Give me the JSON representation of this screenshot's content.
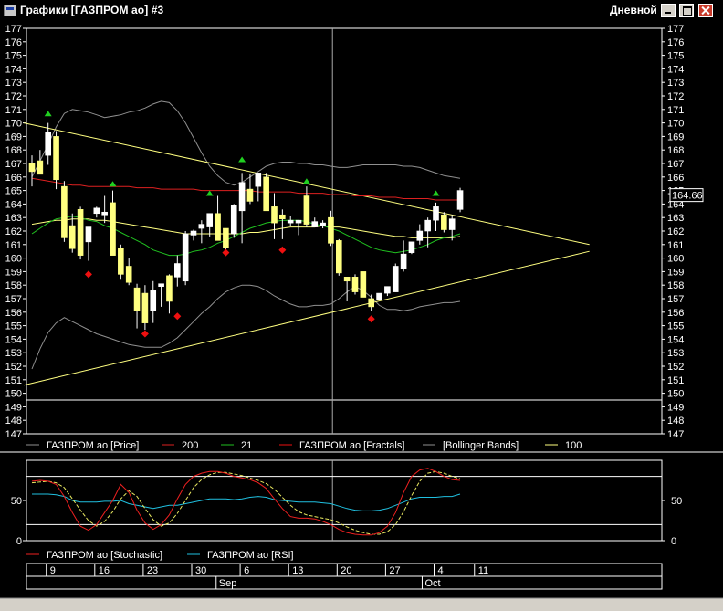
{
  "window": {
    "title": "Графики [ГАЗПРОМ ао] #3",
    "period": "Дневной"
  },
  "colors": {
    "background": "#000000",
    "grid": "#ffffff",
    "candle_up": "#ffffff",
    "candle_down": "#ffff80",
    "ma200": "#dd2020",
    "ma21": "#20c020",
    "ma100": "#ffff80",
    "bollinger": "#909090",
    "fractal_up": "#20d020",
    "fractal_down": "#ee1010",
    "stochastic": "#ee2020",
    "stochastic_signal": "#e8e860",
    "rsi": "#20c0e0",
    "trendline": "#ffff80"
  },
  "legend": [
    {
      "label": "ГАЗПРОМ ао [Price]",
      "color": "#909090"
    },
    {
      "label": "200",
      "color": "#dd2020"
    },
    {
      "label": "21",
      "color": "#20c020"
    },
    {
      "label": "ГАЗПРОМ ао [Fractals]",
      "color": "#ee1010"
    },
    {
      "label": "[Bollinger Bands]",
      "color": "#909090"
    },
    {
      "label": "100",
      "color": "#ffff80"
    }
  ],
  "lower_legend": [
    {
      "label": "ГАЗПРОМ ао [Stochastic]",
      "color": "#ee2020"
    },
    {
      "label": "ГАЗПРОМ ао [RSI]",
      "color": "#20c0e0"
    }
  ],
  "price_axis": {
    "min": 147,
    "max": 177,
    "ticks": [
      "177",
      "176",
      "175",
      "174",
      "173",
      "172",
      "171",
      "170",
      "169",
      "168",
      "167",
      "166",
      "165",
      "164",
      "163",
      "162",
      "161",
      "160",
      "159",
      "158",
      "157",
      "156",
      "155",
      "154",
      "153",
      "152",
      "151",
      "150",
      "149",
      "148",
      "147"
    ]
  },
  "osc_axis": {
    "ticks": [
      "50",
      "0"
    ]
  },
  "last_price_label": "164.66",
  "dates": {
    "day_labels": [
      "9",
      "16",
      "23",
      "30",
      "6",
      "13",
      "20",
      "27",
      "4",
      "11"
    ],
    "month_labels": [
      "Sep",
      "Oct"
    ]
  },
  "chart_data": {
    "type": "candlestick",
    "title": "",
    "ylim": [
      147,
      177
    ],
    "candles": [
      {
        "o": 167.0,
        "h": 167.6,
        "l": 165.3,
        "c": 166.4
      },
      {
        "o": 167.2,
        "h": 168.0,
        "l": 166.3,
        "c": 166.2
      },
      {
        "o": 167.6,
        "h": 170.0,
        "l": 166.9,
        "c": 169.3
      },
      {
        "o": 169.0,
        "h": 169.4,
        "l": 165.1,
        "c": 165.8
      },
      {
        "o": 165.3,
        "h": 165.7,
        "l": 161.2,
        "c": 161.5
      },
      {
        "o": 162.4,
        "h": 163.3,
        "l": 160.4,
        "c": 160.7
      },
      {
        "o": 163.6,
        "h": 163.8,
        "l": 159.9,
        "c": 160.2
      },
      {
        "o": 161.2,
        "h": 162.2,
        "l": 159.8,
        "c": 162.3
      },
      {
        "o": 163.3,
        "h": 163.8,
        "l": 163.0,
        "c": 163.7
      },
      {
        "o": 163.2,
        "h": 164.6,
        "l": 162.6,
        "c": 163.4
      },
      {
        "o": 164.1,
        "h": 165.0,
        "l": 163.6,
        "c": 160.2
      },
      {
        "o": 160.7,
        "h": 161.0,
        "l": 158.4,
        "c": 158.8
      },
      {
        "o": 159.4,
        "h": 160.0,
        "l": 158.0,
        "c": 158.2
      },
      {
        "o": 157.8,
        "h": 158.1,
        "l": 154.8,
        "c": 156.1
      },
      {
        "o": 157.4,
        "h": 158.0,
        "l": 154.7,
        "c": 155.2
      },
      {
        "o": 156.1,
        "h": 158.3,
        "l": 155.2,
        "c": 157.6
      },
      {
        "o": 157.9,
        "h": 158.1,
        "l": 156.4,
        "c": 158.1
      },
      {
        "o": 158.7,
        "h": 158.8,
        "l": 155.9,
        "c": 156.8
      },
      {
        "o": 158.6,
        "h": 160.2,
        "l": 157.9,
        "c": 159.6
      },
      {
        "o": 158.3,
        "h": 162.0,
        "l": 158.0,
        "c": 161.8
      },
      {
        "o": 161.7,
        "h": 162.1,
        "l": 161.3,
        "c": 162.0
      },
      {
        "o": 162.2,
        "h": 162.8,
        "l": 161.1,
        "c": 162.5
      },
      {
        "o": 162.3,
        "h": 163.3,
        "l": 161.6,
        "c": 163.3
      },
      {
        "o": 163.3,
        "h": 164.6,
        "l": 161.5,
        "c": 161.3
      },
      {
        "o": 162.2,
        "h": 162.2,
        "l": 160.5,
        "c": 160.8
      },
      {
        "o": 161.8,
        "h": 164.0,
        "l": 161.5,
        "c": 163.9
      },
      {
        "o": 163.5,
        "h": 166.3,
        "l": 161.1,
        "c": 165.6
      },
      {
        "o": 165.1,
        "h": 166.2,
        "l": 164.0,
        "c": 164.2
      },
      {
        "o": 165.3,
        "h": 166.0,
        "l": 164.2,
        "c": 166.3
      },
      {
        "o": 166.0,
        "h": 166.3,
        "l": 163.5,
        "c": 163.5
      },
      {
        "o": 163.8,
        "h": 164.8,
        "l": 161.4,
        "c": 162.6
      },
      {
        "o": 163.2,
        "h": 163.6,
        "l": 161.4,
        "c": 162.9
      },
      {
        "o": 162.6,
        "h": 163.1,
        "l": 162.4,
        "c": 162.8
      },
      {
        "o": 162.6,
        "h": 162.7,
        "l": 161.7,
        "c": 162.8
      },
      {
        "o": 164.6,
        "h": 165.3,
        "l": 162.3,
        "c": 162.5
      },
      {
        "o": 162.3,
        "h": 163.0,
        "l": 162.3,
        "c": 162.7
      },
      {
        "o": 162.4,
        "h": 162.8,
        "l": 162.2,
        "c": 162.6
      },
      {
        "o": 163.0,
        "h": 163.5,
        "l": 160.9,
        "c": 161.1
      },
      {
        "o": 161.3,
        "h": 161.4,
        "l": 158.7,
        "c": 158.9
      },
      {
        "o": 158.6,
        "h": 158.6,
        "l": 156.8,
        "c": 158.3
      },
      {
        "o": 158.6,
        "h": 158.8,
        "l": 157.3,
        "c": 157.5
      },
      {
        "o": 159.0,
        "h": 159.0,
        "l": 157.2,
        "c": 157.1
      },
      {
        "o": 157.0,
        "h": 157.3,
        "l": 156.1,
        "c": 156.4
      },
      {
        "o": 156.9,
        "h": 157.3,
        "l": 157.0,
        "c": 157.4
      },
      {
        "o": 157.4,
        "h": 157.9,
        "l": 157.2,
        "c": 157.9
      },
      {
        "o": 157.5,
        "h": 159.6,
        "l": 157.5,
        "c": 159.4
      },
      {
        "o": 159.2,
        "h": 161.3,
        "l": 159.0,
        "c": 160.3
      },
      {
        "o": 160.4,
        "h": 161.2,
        "l": 160.3,
        "c": 161.2
      },
      {
        "o": 161.3,
        "h": 162.5,
        "l": 161.0,
        "c": 162.0
      },
      {
        "o": 162.0,
        "h": 163.0,
        "l": 160.8,
        "c": 162.8
      },
      {
        "o": 162.8,
        "h": 164.1,
        "l": 162.0,
        "c": 163.8
      },
      {
        "o": 163.2,
        "h": 163.4,
        "l": 161.9,
        "c": 162.1
      },
      {
        "o": 162.1,
        "h": 163.2,
        "l": 161.3,
        "c": 162.9
      },
      {
        "o": 163.6,
        "h": 165.2,
        "l": 163.4,
        "c": 165.0
      }
    ],
    "ma200": [
      165.9,
      165.8,
      165.7,
      165.6,
      165.5,
      165.4,
      165.4,
      165.3,
      165.3,
      165.3,
      165.3,
      165.3,
      165.3,
      165.2,
      165.2,
      165.2,
      165.1,
      165.1,
      165.1,
      165.1,
      165.1,
      165.0,
      165.0,
      165.0,
      165.0,
      165.0,
      165.0,
      165.0,
      164.9,
      164.9,
      164.9,
      164.9,
      164.9,
      164.8,
      164.8,
      164.8,
      164.8,
      164.7,
      164.7,
      164.7,
      164.6,
      164.6,
      164.6,
      164.5,
      164.5,
      164.5,
      164.4,
      164.4,
      164.4,
      164.4,
      164.3,
      164.3,
      164.3,
      164.3
    ],
    "ma21": [
      161.8,
      162.2,
      162.6,
      162.9,
      163.0,
      163.1,
      163.0,
      162.8,
      162.7,
      162.4,
      162.2,
      161.9,
      161.6,
      161.3,
      161.0,
      160.6,
      160.4,
      160.2,
      160.2,
      160.3,
      160.5,
      160.6,
      160.8,
      161.1,
      161.3,
      161.6,
      161.9,
      162.2,
      162.4,
      162.6,
      162.7,
      162.8,
      162.8,
      162.8,
      162.7,
      162.5,
      162.4,
      162.2,
      162.0,
      161.7,
      161.4,
      161.1,
      160.8,
      160.6,
      160.5,
      160.4,
      160.5,
      160.6,
      160.8,
      161.0,
      161.3,
      161.5,
      161.6,
      161.8
    ],
    "ma100": [
      162.5,
      162.6,
      162.7,
      162.8,
      162.8,
      162.9,
      162.9,
      162.9,
      162.8,
      162.8,
      162.7,
      162.6,
      162.5,
      162.4,
      162.3,
      162.2,
      162.1,
      162.0,
      161.9,
      161.8,
      161.8,
      161.8,
      161.8,
      161.8,
      161.8,
      161.8,
      161.8,
      161.9,
      161.9,
      162.0,
      162.1,
      162.2,
      162.3,
      162.3,
      162.3,
      162.3,
      162.4,
      162.3,
      162.3,
      162.2,
      162.1,
      162.0,
      161.9,
      161.8,
      161.7,
      161.6,
      161.6,
      161.5,
      161.5,
      161.5,
      161.5,
      161.5,
      161.5,
      161.6
    ],
    "bb_upper": [
      166.0,
      167.2,
      168.4,
      169.7,
      170.7,
      171.0,
      170.9,
      170.8,
      170.6,
      170.4,
      170.5,
      170.6,
      170.8,
      170.9,
      171.1,
      171.4,
      171.6,
      171.5,
      170.9,
      170.0,
      168.9,
      167.8,
      166.8,
      166.1,
      165.6,
      165.4,
      165.6,
      166.0,
      166.4,
      166.8,
      167.0,
      167.1,
      167.1,
      167.0,
      167.0,
      166.9,
      166.9,
      166.8,
      166.7,
      166.7,
      166.8,
      166.9,
      166.9,
      166.9,
      166.9,
      166.9,
      166.8,
      166.8,
      166.7,
      166.5,
      166.3,
      166.1,
      166.0,
      165.9
    ],
    "bb_lower": [
      151.8,
      153.3,
      154.5,
      155.2,
      155.6,
      155.3,
      155.0,
      154.7,
      154.4,
      154.2,
      154.0,
      153.8,
      153.6,
      153.5,
      153.4,
      153.4,
      153.4,
      153.7,
      154.1,
      154.7,
      155.3,
      155.9,
      156.4,
      157.0,
      157.5,
      157.8,
      158.0,
      158.0,
      157.9,
      157.6,
      157.2,
      156.9,
      156.6,
      156.4,
      156.4,
      156.5,
      156.5,
      156.6,
      157.0,
      157.5,
      157.9,
      157.6,
      157.1,
      156.5,
      156.2,
      156.2,
      156.1,
      156.2,
      156.4,
      156.5,
      156.6,
      156.7,
      156.7,
      156.8
    ],
    "fractals_up": [
      {
        "i": 2,
        "v": 170.7
      },
      {
        "i": 10,
        "v": 165.5
      },
      {
        "i": 22,
        "v": 164.8
      },
      {
        "i": 26,
        "v": 167.3
      },
      {
        "i": 34,
        "v": 165.7
      },
      {
        "i": 50,
        "v": 164.8
      }
    ],
    "fractals_down": [
      {
        "i": 7,
        "v": 158.8
      },
      {
        "i": 14,
        "v": 154.4
      },
      {
        "i": 18,
        "v": 155.7
      },
      {
        "i": 24,
        "v": 160.4
      },
      {
        "i": 31,
        "v": 160.6
      },
      {
        "i": 42,
        "v": 155.5
      }
    ],
    "trendlines": [
      {
        "i0": -1,
        "v0": 170.0,
        "i1": 69,
        "v1": 161.0
      },
      {
        "i0": -1,
        "v0": 150.6,
        "i1": 69,
        "v1": 160.5
      }
    ],
    "stochastic": [
      74,
      75,
      74,
      70,
      55,
      35,
      18,
      13,
      20,
      35,
      50,
      70,
      60,
      38,
      22,
      14,
      20,
      32,
      52,
      70,
      80,
      84,
      86,
      86,
      84,
      80,
      78,
      76,
      72,
      65,
      52,
      40,
      30,
      28,
      28,
      27,
      24,
      20,
      14,
      10,
      8,
      7,
      7,
      10,
      18,
      35,
      60,
      80,
      88,
      90,
      86,
      80,
      76,
      75
    ],
    "stochastic_signal": [
      72,
      73,
      74,
      72,
      66,
      52,
      38,
      25,
      18,
      24,
      36,
      52,
      62,
      55,
      40,
      26,
      18,
      22,
      34,
      50,
      66,
      76,
      82,
      85,
      85,
      83,
      81,
      78,
      75,
      71,
      64,
      54,
      44,
      36,
      32,
      30,
      28,
      26,
      22,
      17,
      13,
      10,
      8,
      8,
      11,
      20,
      36,
      56,
      74,
      84,
      86,
      84,
      80,
      77
    ],
    "rsi": [
      58,
      58,
      58,
      57,
      55,
      50,
      48,
      48,
      48,
      49,
      49,
      50,
      46,
      44,
      42,
      40,
      42,
      44,
      44,
      46,
      48,
      50,
      52,
      52,
      52,
      51,
      52,
      54,
      55,
      54,
      51,
      50,
      49,
      48,
      48,
      48,
      47,
      46,
      43,
      40,
      38,
      37,
      37,
      38,
      40,
      44,
      48,
      52,
      54,
      54,
      54,
      55,
      55,
      58
    ]
  }
}
